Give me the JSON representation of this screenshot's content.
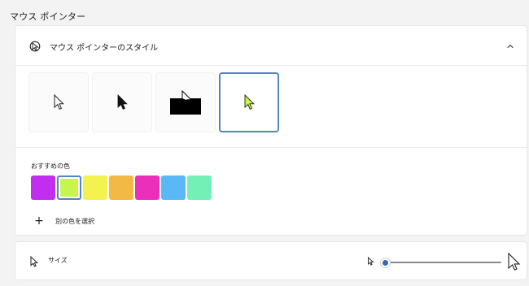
{
  "page": {
    "title": "マウス ポインター"
  },
  "pointer_style": {
    "label": "マウス ポインターのスタイル",
    "header_icon": "pointer-style-icon",
    "collapse_icon": "chevron-up-icon",
    "options": [
      {
        "name": "white-pointer",
        "selected": false
      },
      {
        "name": "black-pointer",
        "selected": false
      },
      {
        "name": "inverted-pointer",
        "selected": false
      },
      {
        "name": "custom-color-pointer",
        "selected": true
      }
    ]
  },
  "recommended_colors": {
    "label": "おすすめの色",
    "swatches": [
      "#c12ef0",
      "#c7f54c",
      "#f4f24f",
      "#f2b945",
      "#eb2fba",
      "#59b8f5",
      "#72f0b5"
    ],
    "selected_index": 1,
    "other_color_label": "別の色を選択",
    "add_icon": "plus-icon"
  },
  "size": {
    "label": "サイズ",
    "icon": "pointer-size-icon",
    "slider_value_fraction": 0.02,
    "min_icon": "small-pointer-icon",
    "max_icon": "large-pointer-icon"
  },
  "colors": {
    "accent": "#4f86c6",
    "slider_accent": "#2f6bbb",
    "background": "#f3f3f3",
    "panel": "#ffffff"
  }
}
